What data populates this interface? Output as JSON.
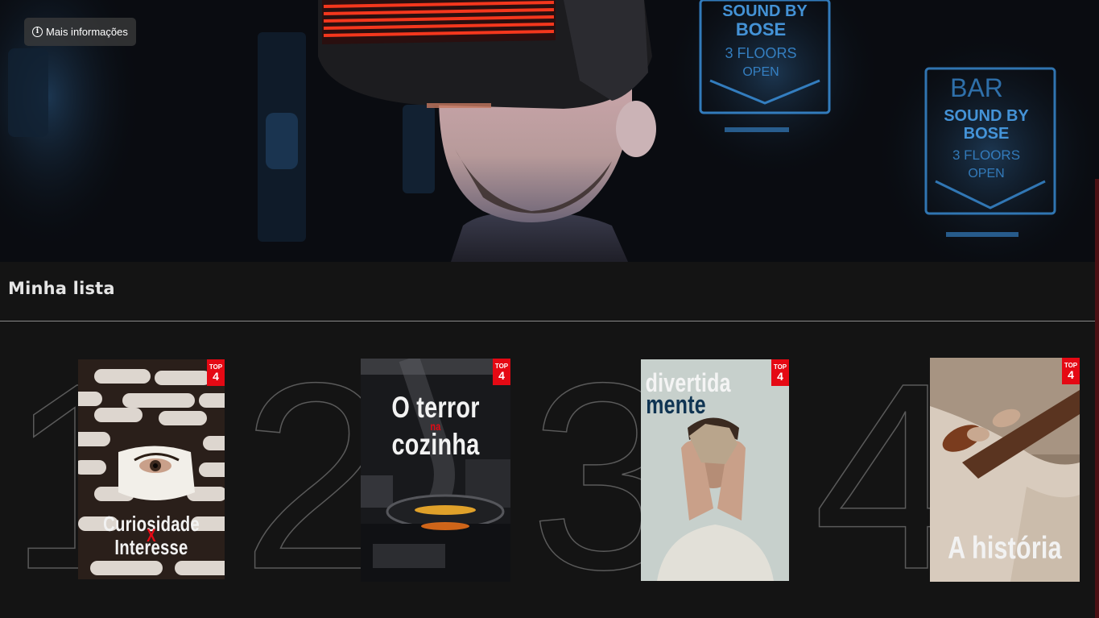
{
  "hero": {
    "info_button_label": "Mais informações",
    "info_icon": "info-icon",
    "backdrop_signs": [
      "SOUND BY",
      "BOSE",
      "3 FLOORS",
      "OPEN",
      "BAR"
    ]
  },
  "section": {
    "title": "Minha lista"
  },
  "badge": {
    "line1": "TOP",
    "line2": "4",
    "color": "#e50914"
  },
  "items": [
    {
      "rank": "1",
      "title_line1": "Curiosidade",
      "connector": "X",
      "title_line2": "Interesse"
    },
    {
      "rank": "2",
      "title_line1": "O terror",
      "connector": "na",
      "title_line2": "cozinha"
    },
    {
      "rank": "3",
      "title_line1": "divertida",
      "title_line2": "mente"
    },
    {
      "rank": "4",
      "title_line1": "A história"
    }
  ],
  "colors": {
    "background": "#141414",
    "accent": "#e50914",
    "rank_outline": "#5a5a5a"
  }
}
